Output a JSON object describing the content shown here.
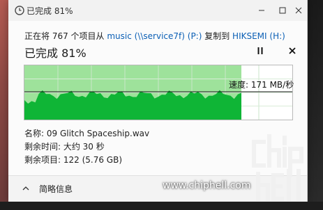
{
  "window": {
    "title": "已完成 81%"
  },
  "copy_line": {
    "prefix": "正在将 767 个项目从 ",
    "source": "music (\\\\service7f) (P:)",
    "middle": " 复制到 ",
    "destination": "HIKSEMI (H:)"
  },
  "progress": {
    "title": "已完成 81%",
    "percent": 81,
    "speed_label": "速度: 171 MB/秒"
  },
  "details": {
    "name": "名称: 09 Glitch Spaceship.wav",
    "time_left": "剩余时间: 大约 30 秒",
    "items_left": "剩余项目: 122 (5.76 GB)"
  },
  "footer": {
    "summary_label": "简略信息"
  },
  "watermark": {
    "text": "www.chiphell.com"
  },
  "colors": {
    "graph_fill": "#0fb536",
    "graph_light": "#9ee29b",
    "link": "#0b5fb5"
  },
  "icons": {
    "title": "progress-clock-icon",
    "pause": "pause-icon",
    "stop": "close-icon",
    "summary": "chevron-up-icon"
  }
}
